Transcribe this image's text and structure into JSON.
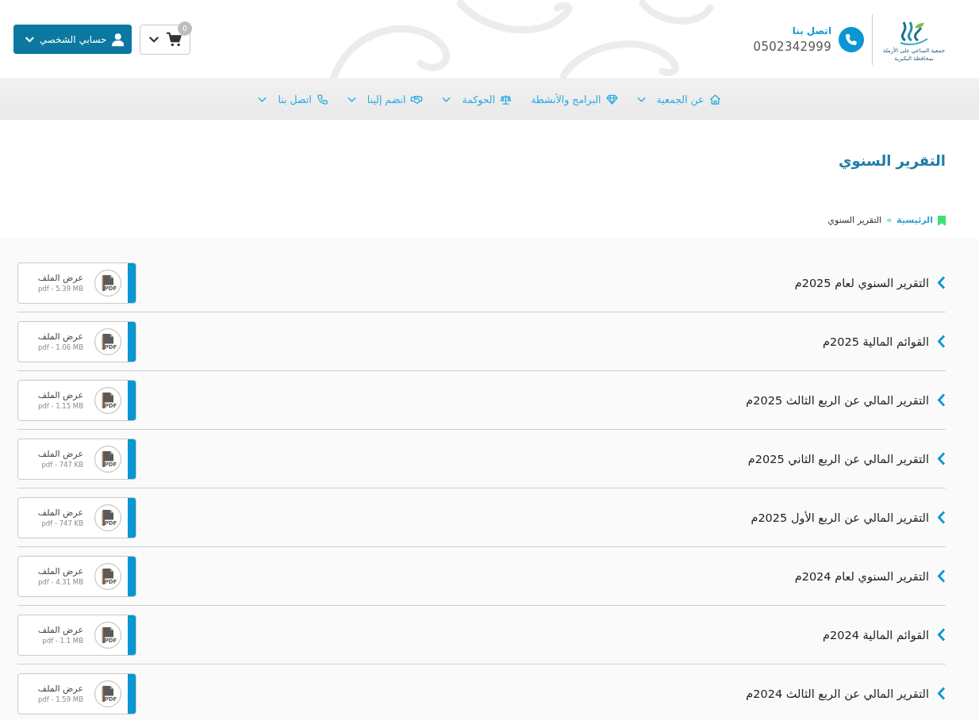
{
  "header": {
    "logo": {
      "lines": [
        "جمعية الساعي على الأرملة",
        "بمحافظة البكيرية"
      ]
    },
    "contact": {
      "label": "اتصل بنا",
      "phone": "0502342999"
    },
    "cart": {
      "count": "0"
    },
    "account": {
      "label": "حسابي الشخصي"
    }
  },
  "nav": [
    {
      "label": "عن الجمعية",
      "dropdown": true
    },
    {
      "label": "البرامج والأنشطة",
      "dropdown": false
    },
    {
      "label": "الحوكمة",
      "dropdown": true
    },
    {
      "label": "انضم إلينا",
      "dropdown": true
    },
    {
      "label": "اتصل بنا",
      "dropdown": true
    }
  ],
  "page": {
    "title": "التقرير السنوي",
    "separator": "»",
    "breadcrumb": [
      {
        "label": "الرئيسية",
        "current": false
      },
      {
        "label": "التقرير السنوي",
        "current": true
      }
    ]
  },
  "files": [
    {
      "title": "التقرير السنوي لعام 2025م",
      "action": "عرض الملف",
      "size": "pdf - 5.39 MB",
      "type": "PDF"
    },
    {
      "title": "القوائم المالية 2025م",
      "action": "عرض الملف",
      "size": "pdf - 1.06 MB",
      "type": "PDF"
    },
    {
      "title": "التقرير المالي عن الربع الثالث 2025م",
      "action": "عرض الملف",
      "size": "pdf - 1.15 MB",
      "type": "PDF"
    },
    {
      "title": "التقرير المالي عن الربع الثاني 2025م",
      "action": "عرض الملف",
      "size": "pdf - 747 KB",
      "type": "PDF"
    },
    {
      "title": "التقرير المالي عن الربع الأول 2025م",
      "action": "عرض الملف",
      "size": "pdf - 747 KB",
      "type": "PDF"
    },
    {
      "title": "التقرير السنوي لعام 2024م",
      "action": "عرض الملف",
      "size": "pdf - 4.31 MB",
      "type": "PDF"
    },
    {
      "title": "القوائم المالية 2024م",
      "action": "عرض الملف",
      "size": "pdf - 1.1 MB",
      "type": "PDF"
    },
    {
      "title": "التقرير المالي عن الربع الثالث 2024م",
      "action": "عرض الملف",
      "size": "pdf - 1.59 MB",
      "type": "PDF"
    }
  ]
}
